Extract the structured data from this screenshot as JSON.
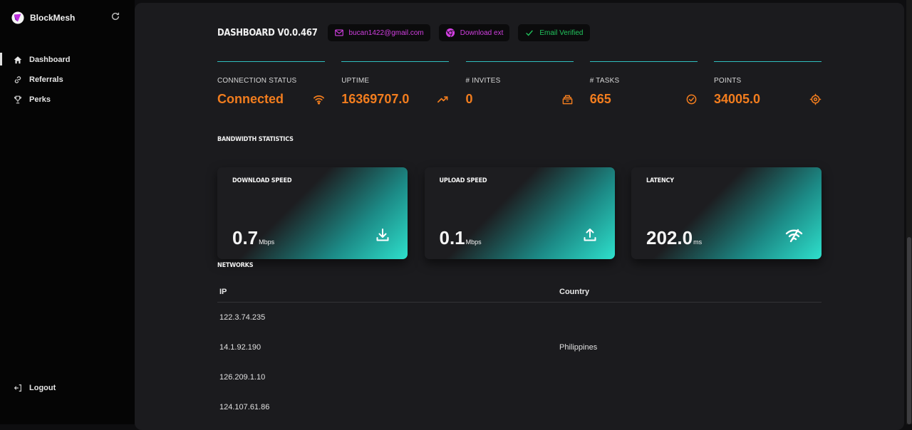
{
  "sidebar": {
    "brand": "BlockMesh",
    "items": [
      {
        "label": "Dashboard",
        "icon": "home-icon",
        "active": true
      },
      {
        "label": "Referrals",
        "icon": "link-icon",
        "active": false
      },
      {
        "label": "Perks",
        "icon": "trophy-icon",
        "active": false
      }
    ],
    "logout_label": "Logout"
  },
  "header": {
    "title": "DASHBOARD V0.0.467",
    "email": "bucan1422@gmail.com",
    "download_ext": "Download ext",
    "email_verified": "Email Verified"
  },
  "stats": [
    {
      "label": "CONNECTION STATUS",
      "value": "Connected",
      "icon": "wifi-icon"
    },
    {
      "label": "UPTIME",
      "value": "16369707.0",
      "icon": "trending-up-icon"
    },
    {
      "label": "# INVITES",
      "value": "0",
      "icon": "invites-icon"
    },
    {
      "label": "# TASKS",
      "value": "665",
      "icon": "check-circle-icon"
    },
    {
      "label": "POINTS",
      "value": "34005.0",
      "icon": "target-icon"
    }
  ],
  "bandwidth": {
    "title": "BANDWIDTH STATISTICS",
    "cards": [
      {
        "label": "DOWNLOAD SPEED",
        "value": "0.7",
        "unit": "Mbps",
        "icon": "download-icon"
      },
      {
        "label": "UPLOAD SPEED",
        "value": "0.1",
        "unit": "Mbps",
        "icon": "upload-icon"
      },
      {
        "label": "LATENCY",
        "value": "202.0",
        "unit": "ms",
        "icon": "wifi-signal-icon"
      }
    ]
  },
  "networks": {
    "title": "NETWORKS",
    "columns": [
      "IP",
      "Country"
    ],
    "rows": [
      {
        "ip": "122.3.74.235",
        "country": ""
      },
      {
        "ip": "14.1.92.190",
        "country": "Philippines"
      },
      {
        "ip": "126.209.1.10",
        "country": ""
      },
      {
        "ip": "124.107.61.86",
        "country": ""
      }
    ]
  },
  "colors": {
    "accent_orange": "#f27d1e",
    "accent_teal": "#2fbfbf",
    "pink": "#d13fe0",
    "green": "#21c45d"
  }
}
